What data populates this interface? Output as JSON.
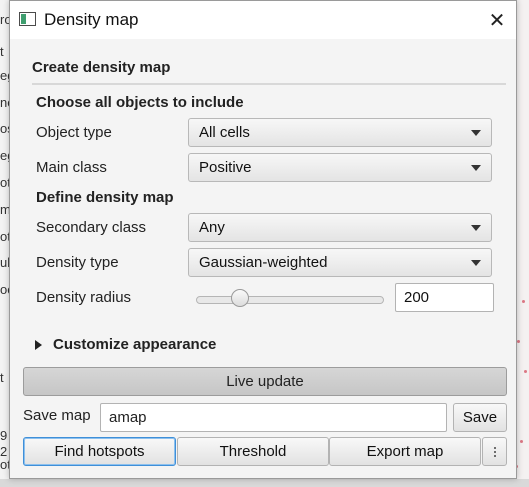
{
  "background": {
    "left_fragments": [
      "ro",
      "t",
      "eg",
      "ne",
      "os",
      "eg",
      "ot",
      "m",
      "ota",
      "ub",
      "oc",
      "t",
      "9",
      "2",
      "ot"
    ]
  },
  "window": {
    "title": "Density map",
    "close_glyph": "✕"
  },
  "section": {
    "title": "Create density map"
  },
  "include_group": {
    "heading": "Choose all objects to include",
    "object_type": {
      "label": "Object type",
      "value": "All cells"
    },
    "main_class": {
      "label": "Main class",
      "value": "Positive"
    }
  },
  "define_group": {
    "heading": "Define density map",
    "secondary_class": {
      "label": "Secondary class",
      "value": "Any"
    },
    "density_type": {
      "label": "Density type",
      "value": "Gaussian-weighted"
    },
    "density_radius": {
      "label": "Density radius",
      "value": "200",
      "slider_fraction": 0.21
    }
  },
  "appearance": {
    "label": "Customize appearance",
    "expanded": false
  },
  "live_update": {
    "label": "Live update"
  },
  "save": {
    "label": "Save map",
    "value": "amap",
    "button": "Save"
  },
  "actions": {
    "find_hotspots": "Find hotspots",
    "threshold": "Threshold",
    "export_map": "Export map",
    "more_icon": "more-vertical-icon"
  },
  "colors": {
    "focus_border": "#3f8fd8",
    "app_icon_green": "#3f9e6f"
  }
}
